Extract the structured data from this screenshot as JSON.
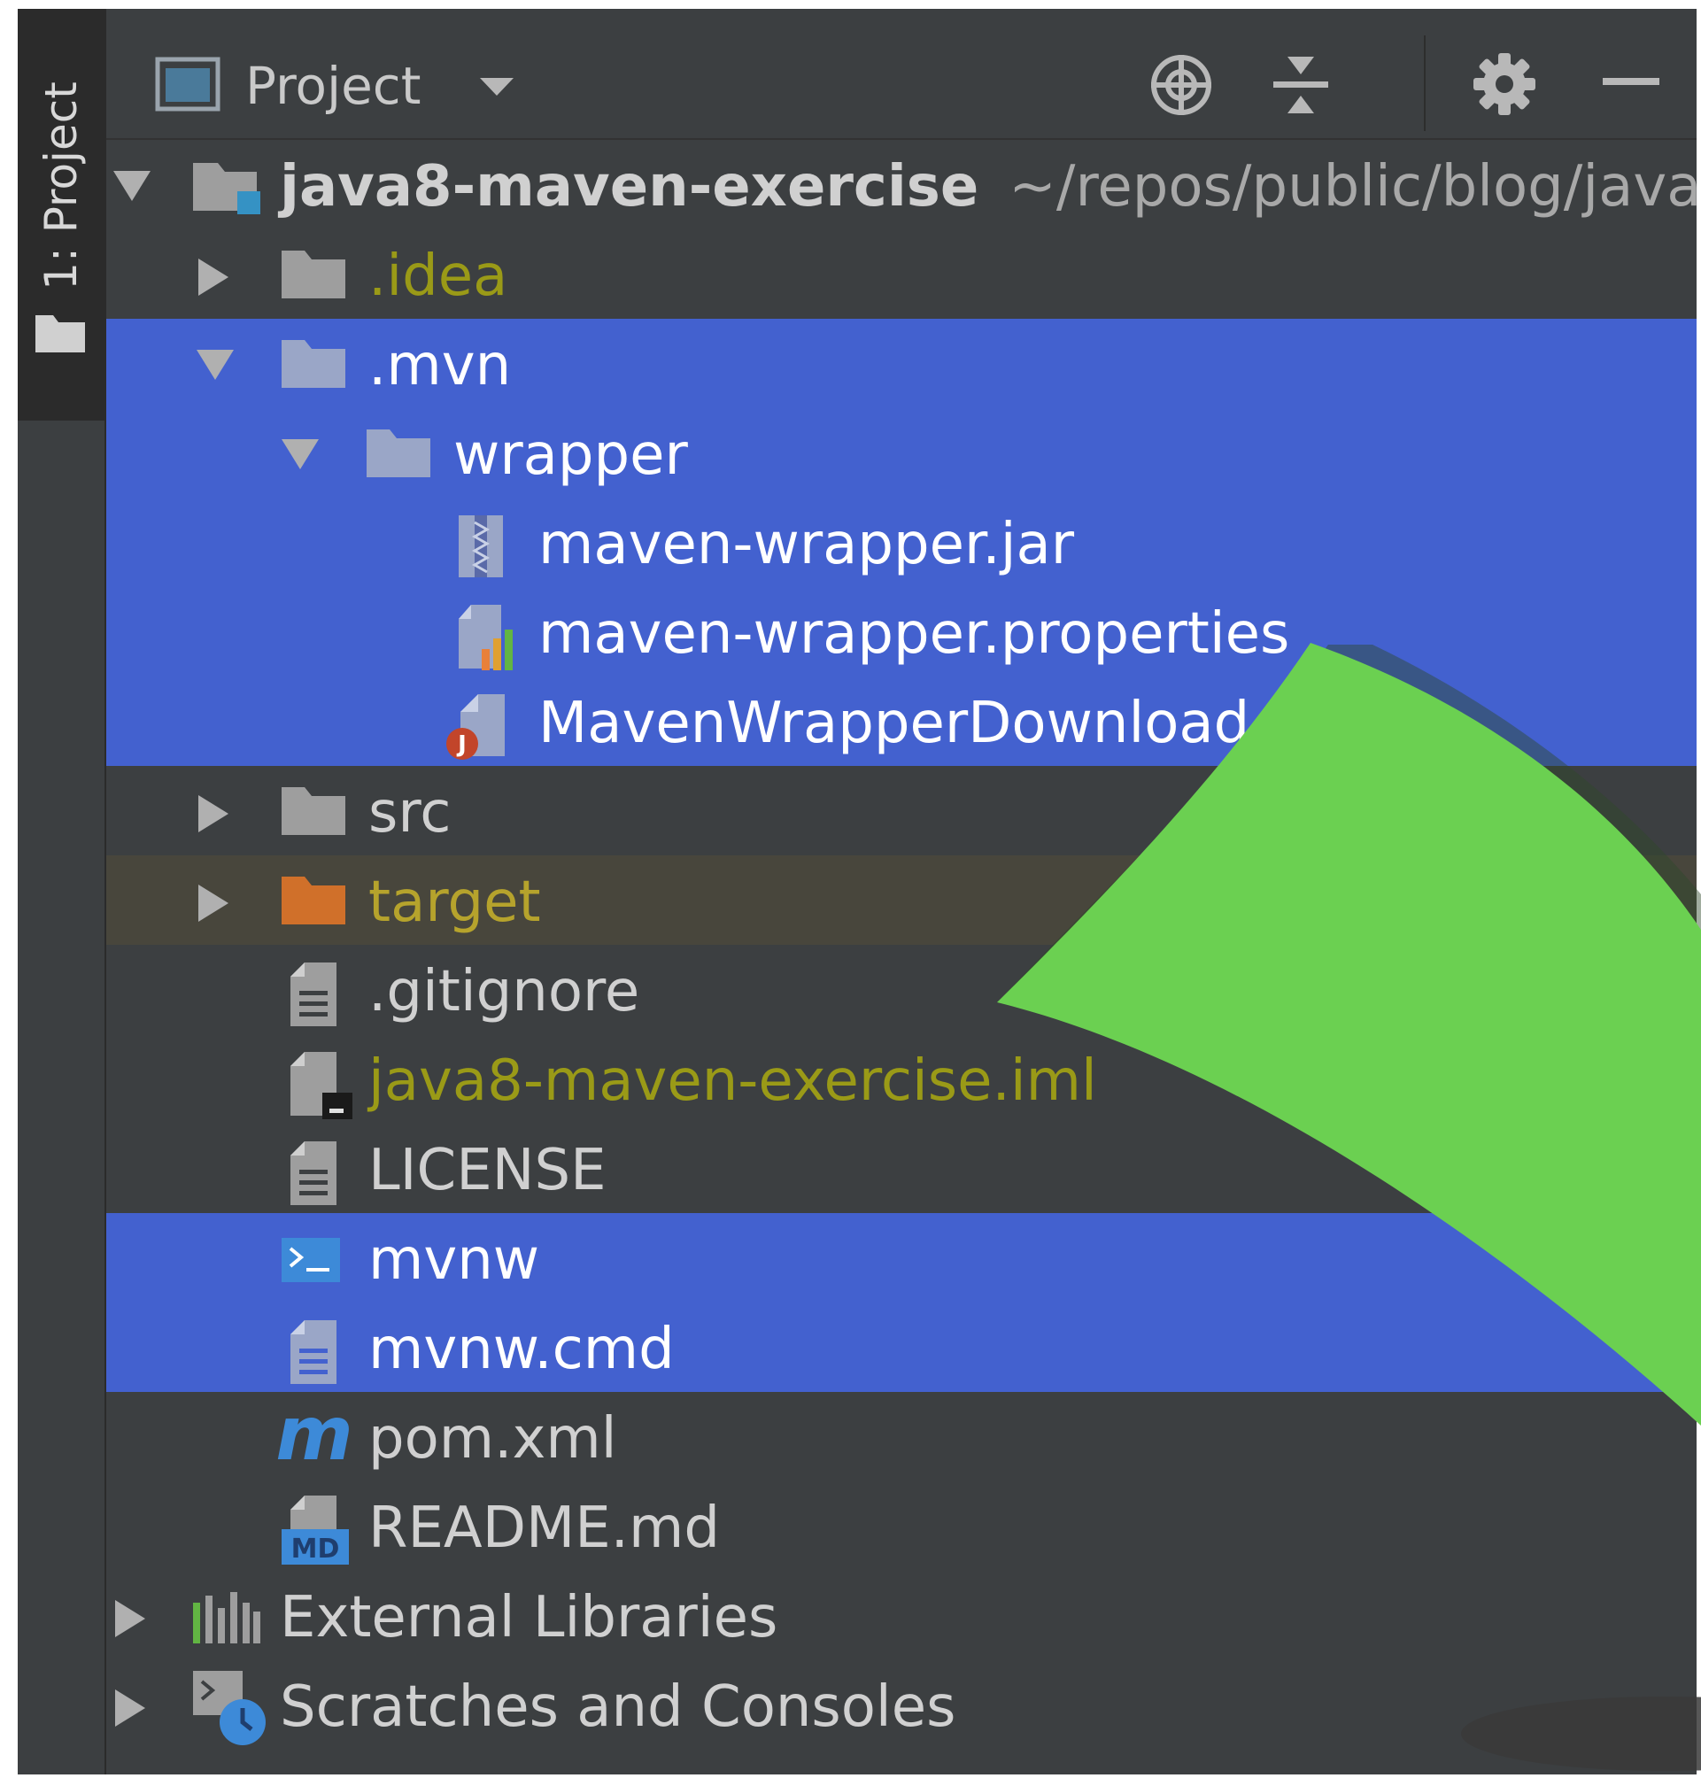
{
  "side_tab": {
    "label": "1: Project"
  },
  "header": {
    "title": "Project"
  },
  "tree": {
    "root": {
      "name": "java8-maven-exercise",
      "path": "~/repos/public/blog/java"
    },
    "idea": ".idea",
    "mvn": ".mvn",
    "wrapper": "wrapper",
    "jar": "maven-wrapper.jar",
    "properties": "maven-wrapper.properties",
    "downloader": "MavenWrapperDownload",
    "src": "src",
    "target": "target",
    "gitignore": ".gitignore",
    "iml": "java8-maven-exercise.iml",
    "license": "LICENSE",
    "mvnw": "mvnw",
    "mvnw_cmd": "mvnw.cmd",
    "pom": "pom.xml",
    "readme": "README.md",
    "external": "External Libraries",
    "scratches": "Scratches and Consoles"
  },
  "icons": {
    "badge_java": "J",
    "badge_md": "MD",
    "badge_maven": "m"
  },
  "colors": {
    "selection": "#4361cf",
    "excluded_row": "#48463c",
    "highlight_arrow": "#6bd051",
    "ignored_text": "#9a9a17"
  }
}
